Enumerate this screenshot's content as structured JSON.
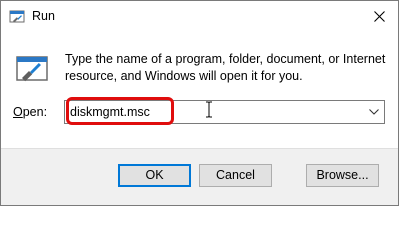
{
  "window": {
    "title": "Run",
    "close_glyph": "✕"
  },
  "dialog": {
    "description": "Type the name of a program, folder, document, or Internet resource, and Windows will open it for you.",
    "open_label_prefix": "O",
    "open_label_rest": "pen:",
    "open_value": "diskmgmt.msc"
  },
  "buttons": {
    "ok": "OK",
    "cancel": "Cancel",
    "browse": "Browse..."
  },
  "icons": {
    "app": "run-app-icon",
    "dialog": "run-dialog-icon",
    "dropdown": "chevron-down-icon",
    "cursor": "text-cursor-icon"
  },
  "colors": {
    "highlight": "#e00d0d",
    "default_button_border": "#0078d7",
    "footer_bg": "#f0f0f0"
  }
}
